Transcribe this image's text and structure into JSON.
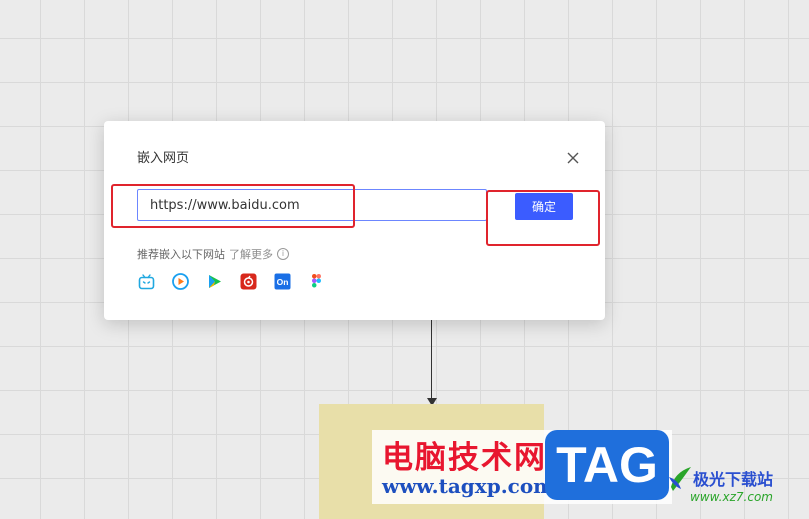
{
  "dialog": {
    "title": "嵌入网页",
    "url_value": "https://www.baidu.com",
    "confirm_label": "确定",
    "recommend_text": "推荐嵌入以下网站",
    "learn_more": "了解更多",
    "info_symbol": "i",
    "sites": [
      {
        "icon": "bilibili-icon"
      },
      {
        "icon": "tencent-video-icon"
      },
      {
        "icon": "iqiyi-icon"
      },
      {
        "icon": "netease-music-icon"
      },
      {
        "icon": "processon-icon"
      },
      {
        "icon": "figma-icon"
      }
    ]
  },
  "watermark": {
    "title": "电脑技术网",
    "url": "www.tagxp.com",
    "badge": "TAG",
    "brand_name": "极光下载站",
    "brand_url": "www.xz7.com"
  },
  "colors": {
    "accent": "#3b5cff",
    "highlight": "#e0242d",
    "sticky": "#e8dfa9"
  }
}
